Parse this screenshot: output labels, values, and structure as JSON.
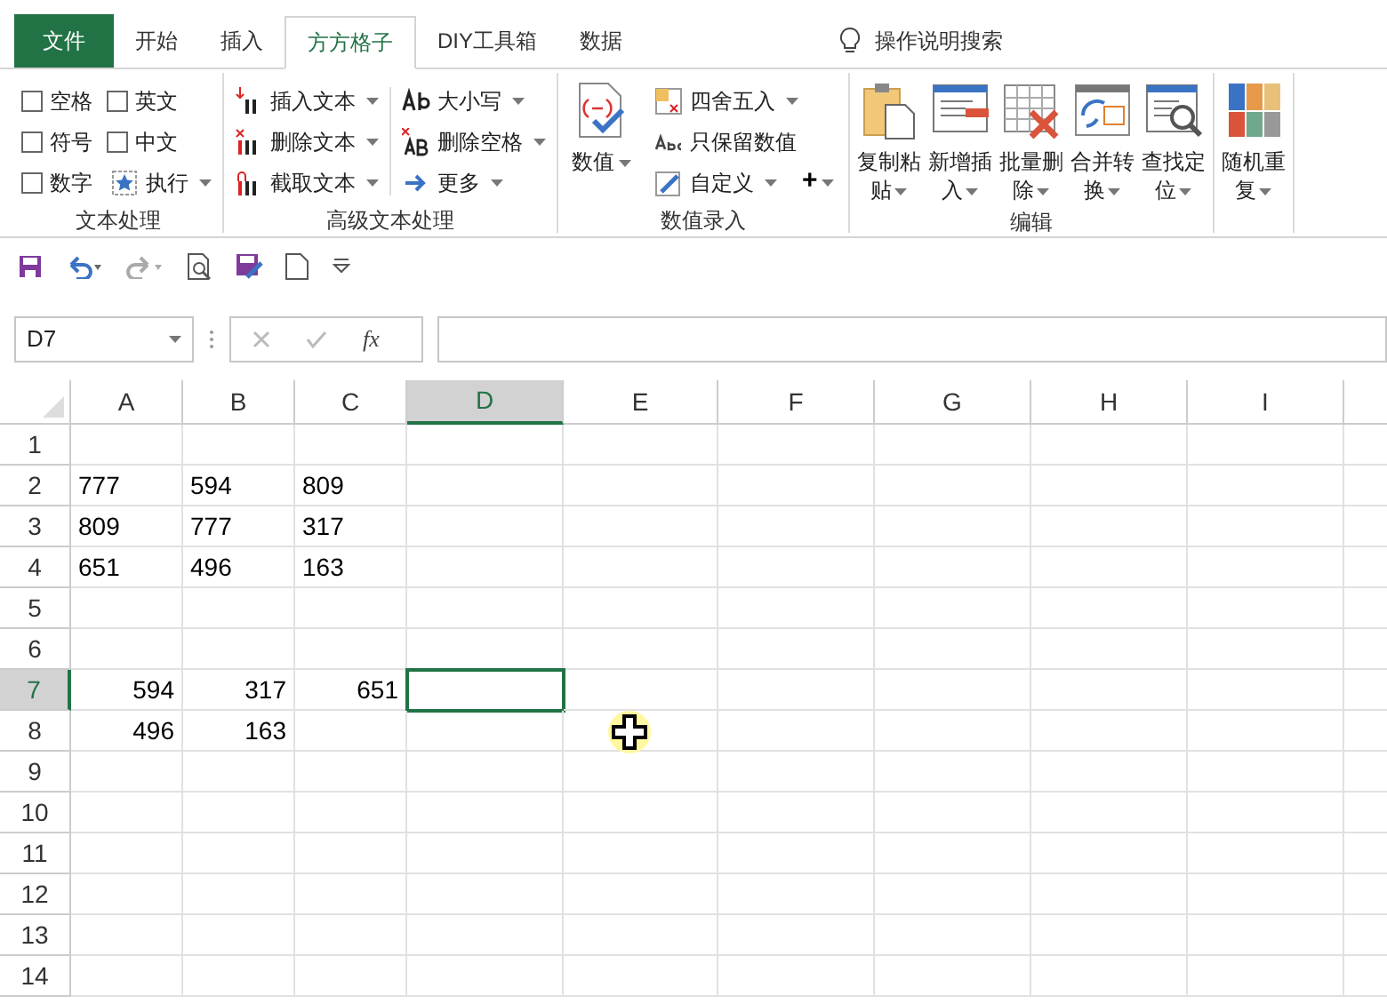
{
  "tabs": [
    {
      "label": "文件",
      "kind": "file",
      "selected": false
    },
    {
      "label": "开始",
      "kind": "tab",
      "selected": false
    },
    {
      "label": "插入",
      "kind": "tab",
      "selected": false
    },
    {
      "label": "方方格子",
      "kind": "tab",
      "selected": true
    },
    {
      "label": "DIY工具箱",
      "kind": "tab",
      "selected": false
    },
    {
      "label": "数据",
      "kind": "tab",
      "selected": false
    }
  ],
  "tell_me": "操作说明搜索",
  "ribbon_groups": [
    {
      "label": "文本处理",
      "kind": "checks",
      "items": [
        {
          "label": "空格",
          "kind": "checkbox",
          "checked": false
        },
        {
          "label": "英文",
          "kind": "checkbox",
          "checked": false
        },
        {
          "label": "符号",
          "kind": "checkbox",
          "checked": false
        },
        {
          "label": "中文",
          "kind": "checkbox",
          "checked": false
        },
        {
          "label": "数字",
          "kind": "checkbox",
          "checked": false
        },
        {
          "label": "执行",
          "kind": "menu"
        }
      ]
    },
    {
      "label": "高级文本处理",
      "kind": "columns",
      "items": [
        {
          "label": "插入文本",
          "kind": "menu"
        },
        {
          "label": "删除文本",
          "kind": "menu"
        },
        {
          "label": "截取文本",
          "kind": "menu"
        },
        {
          "label": "大小写",
          "kind": "menu"
        },
        {
          "label": "删除空格",
          "kind": "menu"
        },
        {
          "label": "更多",
          "kind": "menu"
        }
      ]
    },
    {
      "label": "数值录入",
      "kind": "mixed",
      "items": [
        {
          "label": "数值",
          "kind": "big"
        },
        {
          "label": "四舍五入",
          "kind": "menu"
        },
        {
          "label": "只保留数值",
          "kind": "plain"
        },
        {
          "label": "自定义",
          "kind": "menu"
        },
        {
          "label": "+",
          "kind": "symbol"
        }
      ]
    },
    {
      "label": "编辑",
      "kind": "bigs",
      "items": [
        {
          "label": "复制粘贴",
          "kind": "big"
        },
        {
          "label": "新增插入",
          "kind": "big"
        },
        {
          "label": "批量删除",
          "kind": "big"
        },
        {
          "label": "合并转换",
          "kind": "big"
        },
        {
          "label": "查找定位",
          "kind": "big"
        }
      ]
    },
    {
      "kind": "bigs",
      "items": [
        {
          "label": "随机重复",
          "kind": "big"
        }
      ]
    }
  ],
  "formula_bar": {
    "name_box": "D7",
    "fx": "fx"
  },
  "columns": [
    {
      "label": "A",
      "selected": false
    },
    {
      "label": "B",
      "selected": false
    },
    {
      "label": "C",
      "selected": false
    },
    {
      "label": "D",
      "selected": true
    },
    {
      "label": "E",
      "selected": false
    },
    {
      "label": "F",
      "selected": false
    },
    {
      "label": "G",
      "selected": false
    },
    {
      "label": "H",
      "selected": false
    },
    {
      "label": "I",
      "selected": false
    }
  ],
  "rows": [
    {
      "label": "1",
      "selected": false,
      "kind": "text",
      "cells": []
    },
    {
      "label": "2",
      "selected": false,
      "kind": "text",
      "cells": [
        "777",
        "594",
        "809"
      ]
    },
    {
      "label": "3",
      "selected": false,
      "kind": "text",
      "cells": [
        "809",
        "777",
        "317"
      ]
    },
    {
      "label": "4",
      "selected": false,
      "kind": "text",
      "cells": [
        "651",
        "496",
        "163"
      ]
    },
    {
      "label": "5",
      "selected": false,
      "kind": "text",
      "cells": []
    },
    {
      "label": "6",
      "selected": false,
      "kind": "text",
      "cells": []
    },
    {
      "label": "7",
      "selected": true,
      "kind": "number",
      "cells": [
        "594",
        "317",
        "651"
      ]
    },
    {
      "label": "8",
      "selected": false,
      "kind": "number",
      "cells": [
        "496",
        "163"
      ]
    },
    {
      "label": "9",
      "selected": false,
      "kind": "text",
      "cells": []
    },
    {
      "label": "10",
      "selected": false,
      "kind": "text",
      "cells": []
    },
    {
      "label": "11",
      "selected": false,
      "kind": "text",
      "cells": []
    },
    {
      "label": "12",
      "selected": false,
      "kind": "text",
      "cells": []
    },
    {
      "label": "13",
      "selected": false,
      "kind": "text",
      "cells": []
    },
    {
      "label": "14",
      "selected": false,
      "kind": "text",
      "cells": []
    }
  ]
}
